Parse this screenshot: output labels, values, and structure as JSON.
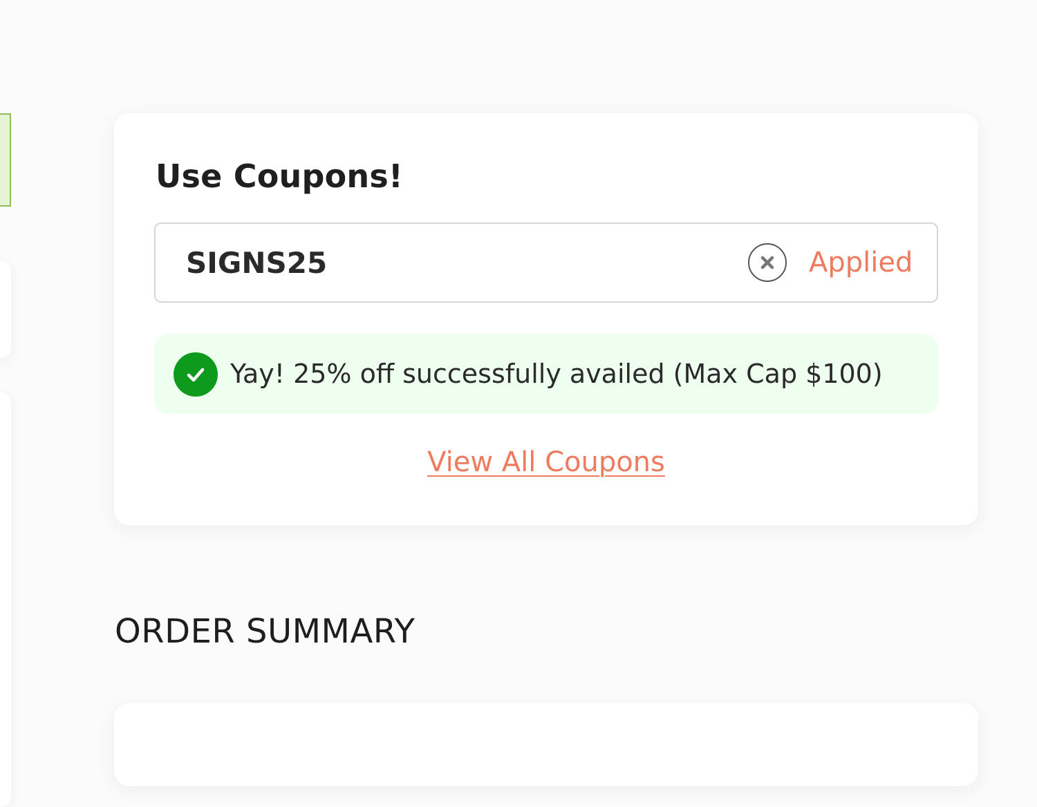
{
  "coupons": {
    "title": "Use Coupons!",
    "code_value": "SIGNS25",
    "status_label": "Applied",
    "success_message": "Yay! 25% off successfully availed (Max Cap $100)",
    "view_all_label": "View All Coupons"
  },
  "order_summary": {
    "title": "ORDER SUMMARY"
  },
  "colors": {
    "accent": "#ef7b5f",
    "success_green": "#0e9a1c",
    "success_bg": "#eefff0"
  },
  "icons": {
    "clear": "close-circle-icon",
    "success": "check-circle-icon"
  }
}
